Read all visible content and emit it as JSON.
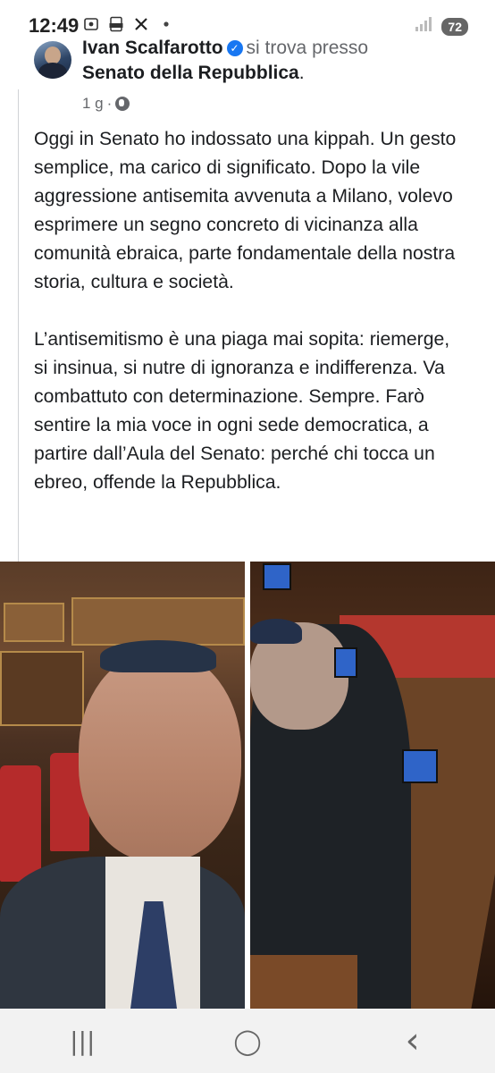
{
  "status_bar": {
    "time": "12:49",
    "icons": [
      "screenshot-icon",
      "pdf-icon",
      "x-icon",
      "dot-icon"
    ],
    "signal_icon": "signal-icon",
    "battery": "72"
  },
  "post": {
    "author": "Ivan Scalfarotto",
    "verified": true,
    "location_prefix": "si trova presso",
    "location": "Senato della Repubblica",
    "location_suffix": ".",
    "time_ago": "1 g",
    "separator": "·",
    "privacy_icon": "globe-icon",
    "paragraph1": "Oggi in Senato ho indossato una kippah. Un gesto semplice, ma carico di significato. Dopo la vile aggressione antisemita avvenuta a Milano, volevo esprimere un segno concreto di vicinanza alla comunità ebraica, parte fondamentale della nostra storia, cultura e società.",
    "paragraph2": "L’antisemitismo è una piaga mai sopita: riemerge, si insinua, si nutre di ignoranza e indifferenza. Va combattuto con determinazione. Sempre. Farò sentire la mia voce in ogni sede democratica, a partire dall’Aula del Senato: perché chi tocca un ebreo, offende la Repubblica."
  },
  "photos": [
    {
      "name": "selfie-photo"
    },
    {
      "name": "senate-seat-photo"
    }
  ],
  "nav_bar": {
    "recent_glyph": "|||",
    "home_glyph": "◯",
    "back_glyph": "‹"
  }
}
